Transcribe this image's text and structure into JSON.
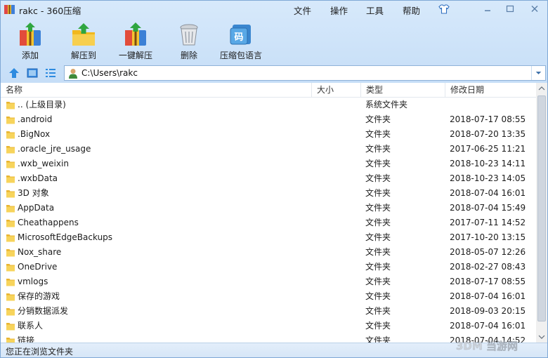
{
  "window": {
    "title": "rakc - 360压缩",
    "menus": [
      "文件",
      "操作",
      "工具",
      "帮助"
    ],
    "controls": {
      "skin": "shirt-icon",
      "minimize": "minimize-icon",
      "maximize": "maximize-icon",
      "close": "close-icon"
    }
  },
  "toolbar": {
    "add": "添加",
    "extract_to": "解压到",
    "one_click_extract": "一键解压",
    "delete": "删除",
    "language": "压缩包语言",
    "lang_glyph": "码"
  },
  "address": {
    "path": "C:\\Users\\rakc",
    "nav_icons": [
      "up-arrow-icon",
      "thumbnail-view-icon",
      "list-view-icon"
    ]
  },
  "columns": {
    "name": "名称",
    "size": "大小",
    "type": "类型",
    "modified": "修改日期"
  },
  "rows": [
    {
      "name": ".. (上级目录)",
      "type": "系统文件夹",
      "date": ""
    },
    {
      "name": ".android",
      "type": "文件夹",
      "date": "2018-07-17 08:55"
    },
    {
      "name": ".BigNox",
      "type": "文件夹",
      "date": "2018-07-20 13:35"
    },
    {
      "name": ".oracle_jre_usage",
      "type": "文件夹",
      "date": "2017-06-25 11:21"
    },
    {
      "name": ".wxb_weixin",
      "type": "文件夹",
      "date": "2018-10-23 14:11"
    },
    {
      "name": ".wxbData",
      "type": "文件夹",
      "date": "2018-10-23 14:05"
    },
    {
      "name": "3D 对象",
      "type": "文件夹",
      "date": "2018-07-04 16:01"
    },
    {
      "name": "AppData",
      "type": "文件夹",
      "date": "2018-07-04 15:49"
    },
    {
      "name": "Cheathappens",
      "type": "文件夹",
      "date": "2017-07-11 14:52"
    },
    {
      "name": "MicrosoftEdgeBackups",
      "type": "文件夹",
      "date": "2017-10-20 13:15"
    },
    {
      "name": "Nox_share",
      "type": "文件夹",
      "date": "2018-05-07 12:26"
    },
    {
      "name": "OneDrive",
      "type": "文件夹",
      "date": "2018-02-27 08:43"
    },
    {
      "name": "vmlogs",
      "type": "文件夹",
      "date": "2018-07-17 08:55"
    },
    {
      "name": "保存的游戏",
      "type": "文件夹",
      "date": "2018-07-04 16:01"
    },
    {
      "name": "分销数据派发",
      "type": "文件夹",
      "date": "2018-09-03 20:15"
    },
    {
      "name": "联系人",
      "type": "文件夹",
      "date": "2018-07-04 16:01"
    },
    {
      "name": "链接",
      "type": "文件夹",
      "date": "2018-07-04 14:52"
    }
  ],
  "status": {
    "text": "您正在浏览文件夹"
  },
  "watermark": {
    "text": "3DM 当游网"
  }
}
